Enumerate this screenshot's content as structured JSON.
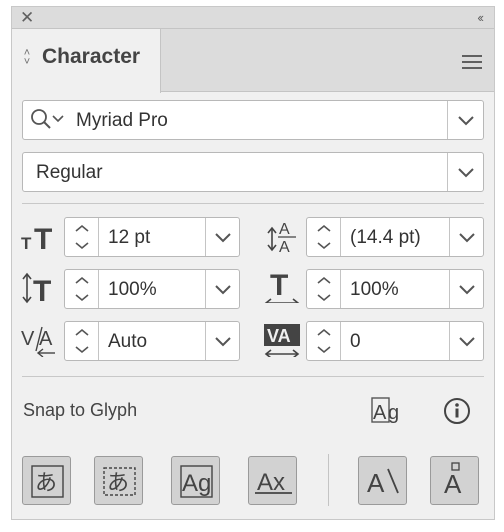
{
  "panel": {
    "tab_title": "Character"
  },
  "font": {
    "family": "Myriad Pro",
    "style": "Regular"
  },
  "fields": {
    "font_size": "12 pt",
    "leading": "(14.4 pt)",
    "vertical_scale": "100%",
    "horizontal_scale": "100%",
    "kerning": "Auto",
    "tracking": "0"
  },
  "snap": {
    "label": "Snap to Glyph"
  },
  "icons": {
    "close": "close-icon",
    "collapse": "double-chevron-left-icon",
    "menu": "hamburger-menu-icon",
    "search": "search-icon",
    "info": "info-icon"
  },
  "colors": {
    "panel_bg": "#f0f0f0",
    "header_bg": "#dcdcdc",
    "button_bg": "#d2d2d2",
    "field_bg": "#ffffff"
  }
}
